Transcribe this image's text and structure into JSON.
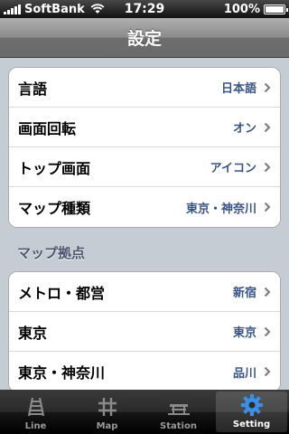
{
  "status_bar": {
    "carrier": "SoftBank",
    "time": "17:29",
    "battery": "100%",
    "battery_level": 1.0
  },
  "nav": {
    "title": "設定"
  },
  "groups": [
    {
      "rows": [
        {
          "label": "言語",
          "value": "日本語"
        },
        {
          "label": "画面回転",
          "value": "オン"
        },
        {
          "label": "トップ画面",
          "value": "アイコン"
        },
        {
          "label": "マップ種類",
          "value": "東京・神奈川"
        }
      ]
    }
  ],
  "section_header": "マップ拠点",
  "map_bases": [
    {
      "label": "メトロ・都営",
      "value": "新宿"
    },
    {
      "label": "東京",
      "value": "東京"
    },
    {
      "label": "東京・神奈川",
      "value": "品川"
    }
  ],
  "tabs": [
    {
      "label": "Line",
      "icon": "railway-icon"
    },
    {
      "label": "Map",
      "icon": "grid-icon"
    },
    {
      "label": "Station",
      "icon": "station-icon"
    },
    {
      "label": "Setting",
      "icon": "gear-icon"
    }
  ],
  "colors": {
    "value_text": "#385487",
    "active_tab_icon": "#3a8fe6"
  }
}
